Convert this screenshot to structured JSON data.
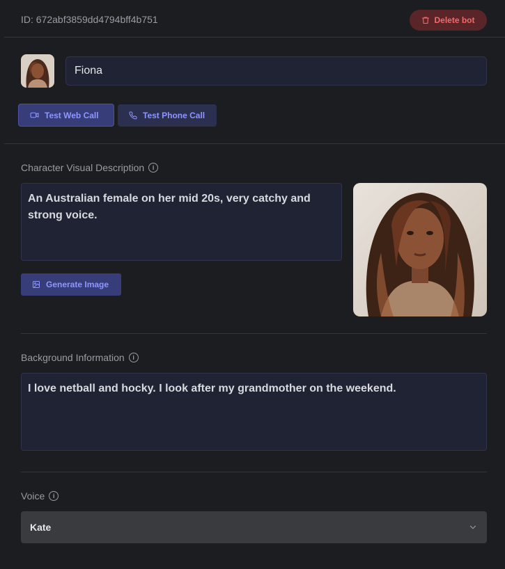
{
  "header": {
    "id_text": "ID: 672abf3859dd4794bff4b751",
    "delete_label": "Delete bot"
  },
  "bot": {
    "name": "Fiona",
    "web_call_label": "Test Web Call",
    "phone_call_label": "Test Phone Call"
  },
  "visual": {
    "label": "Character Visual Description",
    "description": "An Australian female on her mid 20s, very catchy and strong voice.",
    "generate_label": "Generate Image"
  },
  "background": {
    "label": "Background Information",
    "text": "I love netball and hocky.  I look after my grandmother on the weekend."
  },
  "voice": {
    "label": "Voice",
    "selected": "Kate"
  },
  "colors": {
    "accent": "#8e96ff",
    "danger": "#f26a6a",
    "background": "#1c1d21"
  }
}
